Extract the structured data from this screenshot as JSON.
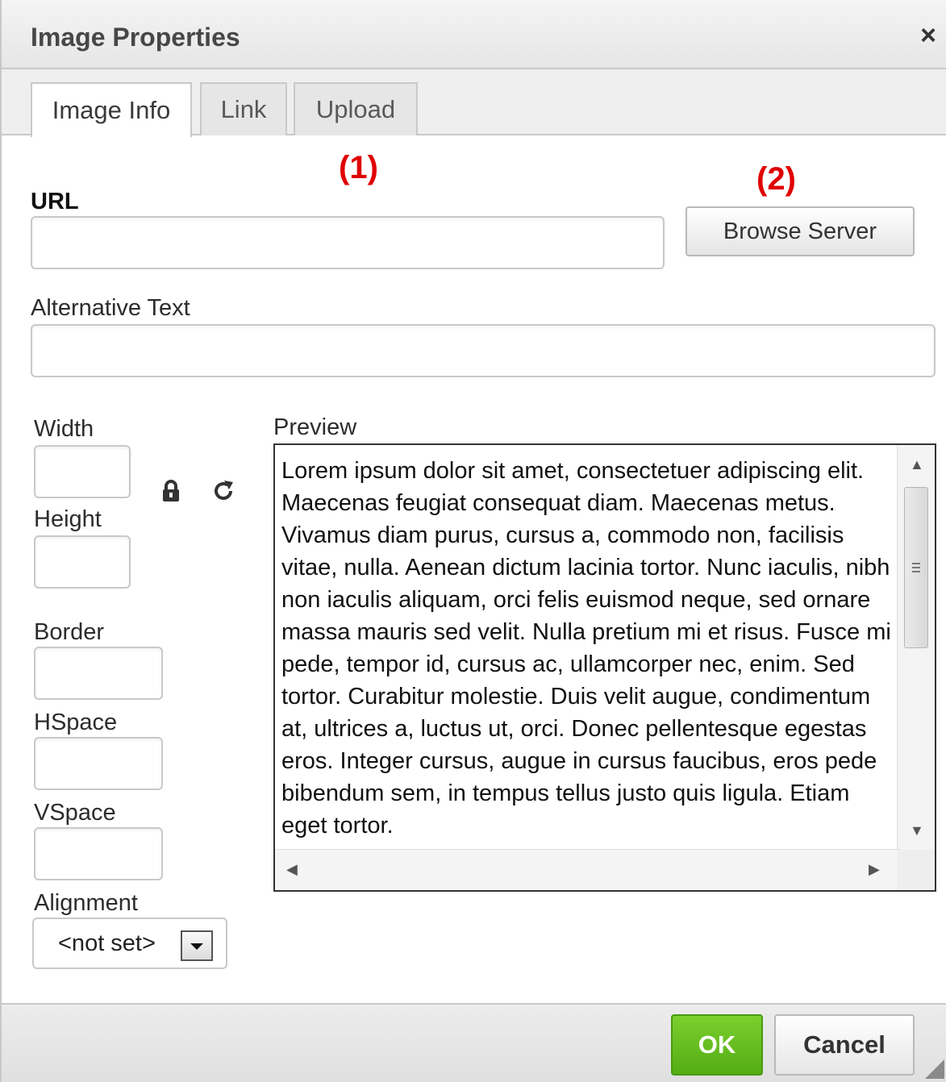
{
  "dialog": {
    "title": "Image Properties",
    "close_glyph": "×"
  },
  "tabs": [
    {
      "label": "Image Info",
      "active": true
    },
    {
      "label": "Link",
      "active": false
    },
    {
      "label": "Upload",
      "active": false
    }
  ],
  "annotations": {
    "one": "(1)",
    "two": "(2)",
    "color": "#e00000"
  },
  "form": {
    "url_label": "URL",
    "url_value": "",
    "browse_label": "Browse Server",
    "alt_label": "Alternative Text",
    "alt_value": "",
    "width_label": "Width",
    "height_label": "Height",
    "border_label": "Border",
    "hspace_label": "HSpace",
    "vspace_label": "VSpace",
    "alignment_label": "Alignment",
    "alignment_value": "<not set>",
    "lock_icon": "lock-icon",
    "reset_icon": "reset-size-icon"
  },
  "preview": {
    "label": "Preview",
    "text": "Lorem ipsum dolor sit amet, consectetuer adipiscing elit. Maecenas feugiat consequat diam. Maecenas metus. Vivamus diam purus, cursus a, commodo non, facilisis vitae, nulla. Aenean dictum lacinia tortor. Nunc iaculis, nibh non iaculis aliquam, orci felis euismod neque, sed ornare massa mauris sed velit. Nulla pretium mi et risus. Fusce mi pede, tempor id, cursus ac, ullamcorper nec, enim. Sed tortor. Curabitur molestie. Duis velit augue, condimentum at, ultrices a, luctus ut, orci. Donec pellentesque egestas eros. Integer cursus, augue in cursus faucibus, eros pede bibendum sem, in tempus tellus justo quis ligula. Etiam eget tortor."
  },
  "footer": {
    "ok_label": "OK",
    "cancel_label": "Cancel",
    "ok_color": "#5fb91e"
  }
}
